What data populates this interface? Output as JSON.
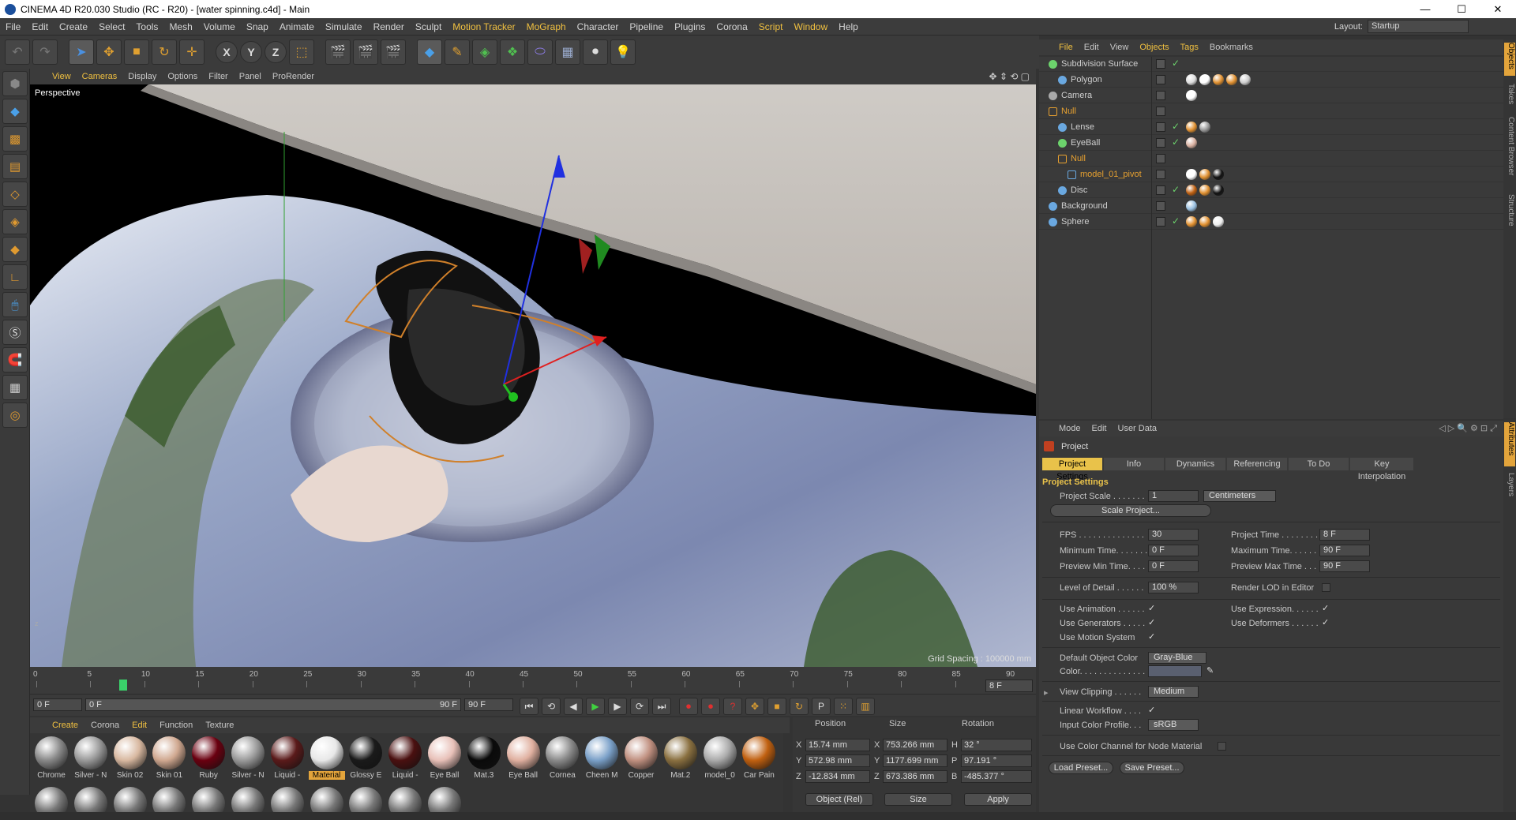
{
  "titlebar": {
    "title": "CINEMA 4D R20.030 Studio (RC - R20) - [water spinning.c4d] - Main",
    "min": "—",
    "max": "☐",
    "close": "✕"
  },
  "menubar": {
    "items": [
      "File",
      "Edit",
      "Create",
      "Select",
      "Tools",
      "Mesh",
      "Volume",
      "Snap",
      "Animate",
      "Simulate",
      "Render",
      "Sculpt",
      "Motion Tracker",
      "MoGraph",
      "Character",
      "Pipeline",
      "Plugins",
      "Corona",
      "Script",
      "Window",
      "Help"
    ],
    "layout_label": "Layout:",
    "layout_value": "Startup"
  },
  "toolbar": {
    "x": "X",
    "y": "Y",
    "z": "Z"
  },
  "viewport": {
    "menu": [
      "View",
      "Cameras",
      "Display",
      "Options",
      "Filter",
      "Panel",
      "ProRender"
    ],
    "label": "Perspective",
    "grid_spacing": "Grid Spacing : 100000 mm"
  },
  "timeline": {
    "ticks": [
      "0",
      "5",
      "10",
      "15",
      "20",
      "25",
      "30",
      "35",
      "40",
      "45",
      "50",
      "55",
      "60",
      "65",
      "70",
      "75",
      "80",
      "85",
      "90"
    ],
    "current_marker": "8",
    "current_field": "8 F",
    "start_field": "0 F",
    "range_start": "0 F",
    "range_end": "90 F",
    "end_field": "90 F"
  },
  "materials": {
    "menu": [
      "Create",
      "Corona",
      "Edit",
      "Function",
      "Texture"
    ],
    "items": [
      {
        "label": "Chrome",
        "color": "#888"
      },
      {
        "label": "Silver - N",
        "color": "#999"
      },
      {
        "label": "Skin 02",
        "color": "#d8b8a0"
      },
      {
        "label": "Skin 01",
        "color": "#d0a890"
      },
      {
        "label": "Ruby",
        "color": "#6a0010"
      },
      {
        "label": "Silver - N",
        "color": "#9a9a9a"
      },
      {
        "label": "Liquid -",
        "color": "#5a1a1a"
      },
      {
        "label": "Material",
        "color": "#e8e8e8"
      },
      {
        "label": "Glossy E",
        "color": "#1a1a1a"
      },
      {
        "label": "Liquid -",
        "color": "#4a1010"
      },
      {
        "label": "Eye Ball",
        "color": "#e8c0b8"
      },
      {
        "label": "Mat.3",
        "color": "#0a0a0a"
      },
      {
        "label": "Eye Ball",
        "color": "#e0b0a0"
      },
      {
        "label": "Cornea",
        "color": "#8a8a8a"
      },
      {
        "label": "Cheen M",
        "color": "#7aa0c8"
      },
      {
        "label": "Copper",
        "color": "#c09080"
      },
      {
        "label": "Mat.2",
        "color": "#8a7040"
      },
      {
        "label": "model_0",
        "color": "#aaaaaa"
      },
      {
        "label": "Car Pain",
        "color": "#c06010"
      }
    ]
  },
  "coords": {
    "headers": [
      "Position",
      "Size",
      "Rotation"
    ],
    "rows": [
      {
        "axis": "X",
        "pos": "15.74 mm",
        "size_axis": "X",
        "size": "753.266 mm",
        "rot_axis": "H",
        "rot": "32 °"
      },
      {
        "axis": "Y",
        "pos": "572.98 mm",
        "size_axis": "Y",
        "size": "1177.699 mm",
        "rot_axis": "P",
        "rot": "97.191 °"
      },
      {
        "axis": "Z",
        "pos": "-12.834 mm",
        "size_axis": "Z",
        "size": "673.386 mm",
        "rot_axis": "B",
        "rot": "-485.377 °"
      }
    ],
    "mode": "Object (Rel)",
    "size_mode": "Size",
    "apply": "Apply"
  },
  "objects": {
    "menu": [
      "File",
      "Edit",
      "View",
      "Objects",
      "Tags",
      "Bookmarks"
    ],
    "rows": [
      {
        "name": "Subdivision Surface",
        "indent": 0,
        "null": false,
        "icon": "#6cd36c",
        "check": "✓",
        "tags": []
      },
      {
        "name": "Polygon",
        "indent": 1,
        "null": false,
        "icon": "#6aa8e0",
        "check": "",
        "tags": [
          "#ddd",
          "#fff",
          "#e09030",
          "#e09030",
          "#ccc"
        ]
      },
      {
        "name": "Camera",
        "indent": 0,
        "null": false,
        "icon": "#aaa",
        "check": "",
        "tags": [
          "#fff"
        ]
      },
      {
        "name": "Null",
        "indent": 0,
        "null": true,
        "icon": "#e6a030",
        "check": "",
        "tags": []
      },
      {
        "name": "Lense",
        "indent": 1,
        "null": false,
        "icon": "#6aa8e0",
        "check": "✓",
        "tags": [
          "#e09030",
          "#999"
        ]
      },
      {
        "name": "EyeBall",
        "indent": 1,
        "null": false,
        "icon": "#6cd36c",
        "check": "✓",
        "tags": [
          "#d8b0a0"
        ]
      },
      {
        "name": "Null",
        "indent": 1,
        "null": true,
        "icon": "#e6a030",
        "check": "",
        "tags": []
      },
      {
        "name": "model_01_pivot",
        "indent": 2,
        "null": true,
        "icon": "#6aa8e0",
        "check": "",
        "tags": [
          "#fff",
          "#e09030",
          "#111"
        ]
      },
      {
        "name": "Disc",
        "indent": 1,
        "null": false,
        "icon": "#6aa8e0",
        "check": "✓",
        "tags": [
          "#c06010",
          "#e09030",
          "#111"
        ]
      },
      {
        "name": "Background",
        "indent": 0,
        "null": false,
        "icon": "#6aa8e0",
        "check": "",
        "tags": [
          "#9ac0e0"
        ]
      },
      {
        "name": "Sphere",
        "indent": 0,
        "null": false,
        "icon": "#6aa8e0",
        "check": "✓",
        "tags": [
          "#e09030",
          "#e09030",
          "#eee"
        ]
      }
    ]
  },
  "side_tabs_top": [
    "Objects",
    "Takes",
    "Content Browser",
    "Structure"
  ],
  "side_tabs_bottom": [
    "Attributes",
    "Layers"
  ],
  "attributes": {
    "menu": [
      "Mode",
      "Edit",
      "User Data"
    ],
    "object_title": "Project",
    "tabs": [
      "Project Settings",
      "Info",
      "Dynamics",
      "Referencing",
      "To Do",
      "Key Interpolation"
    ],
    "section": "Project Settings",
    "project_scale_label": "Project Scale . . . . . . .",
    "project_scale": "1",
    "project_scale_unit": "Centimeters",
    "scale_project_btn": "Scale Project...",
    "fps_label": "FPS . . . . . . . . . . . . . .",
    "fps": "30",
    "project_time_label": "Project Time . . . . . . . .",
    "project_time": "8 F",
    "min_time_label": "Minimum Time. . . . . . .",
    "min_time": "0 F",
    "max_time_label": "Maximum Time. . . . . . .",
    "max_time": "90 F",
    "prev_min_label": "Preview Min Time. . . .",
    "prev_min": "0 F",
    "prev_max_label": "Preview Max Time . . . .",
    "prev_max": "90 F",
    "lod_label": "Level of Detail . . . . . .",
    "lod": "100 %",
    "render_lod_label": "Render LOD in Editor",
    "use_anim_label": "Use Animation . . . . . .",
    "use_expr_label": "Use Expression. . . . . .",
    "use_gen_label": "Use Generators . . . . .",
    "use_def_label": "Use Deformers . . . . . .",
    "use_motion_label": "Use Motion System",
    "default_color_label": "Default Object Color",
    "default_color": "Gray-Blue",
    "color_label": "Color. . . . . . . . . . . . . .",
    "view_clip_label": "View Clipping . . . . . .",
    "view_clip": "Medium",
    "linear_wf_label": "Linear Workflow . . . .",
    "input_profile_label": "Input Color Profile. . .",
    "input_profile": "sRGB",
    "node_mat_label": "Use Color Channel for Node Material",
    "load_preset": "Load Preset...",
    "save_preset": "Save Preset...",
    "check": "✓"
  }
}
